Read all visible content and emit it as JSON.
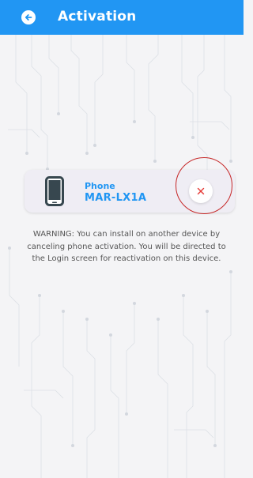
{
  "app_bar": {
    "title": "Activation",
    "back_icon": "back-arrow-circle-icon",
    "background": "#2196f3"
  },
  "device_card": {
    "icon": "smartphone-icon",
    "type_label": "Phone",
    "model": "MAR-LX1A",
    "cancel_icon": "close-icon",
    "accent_color": "#2196f3",
    "cancel_color": "#e53935",
    "highlight_color": "#c62828"
  },
  "warning_text": "WARNING: You can install on another device by canceling phone activation. You will be directed to the Login screen for reactivation on this device."
}
